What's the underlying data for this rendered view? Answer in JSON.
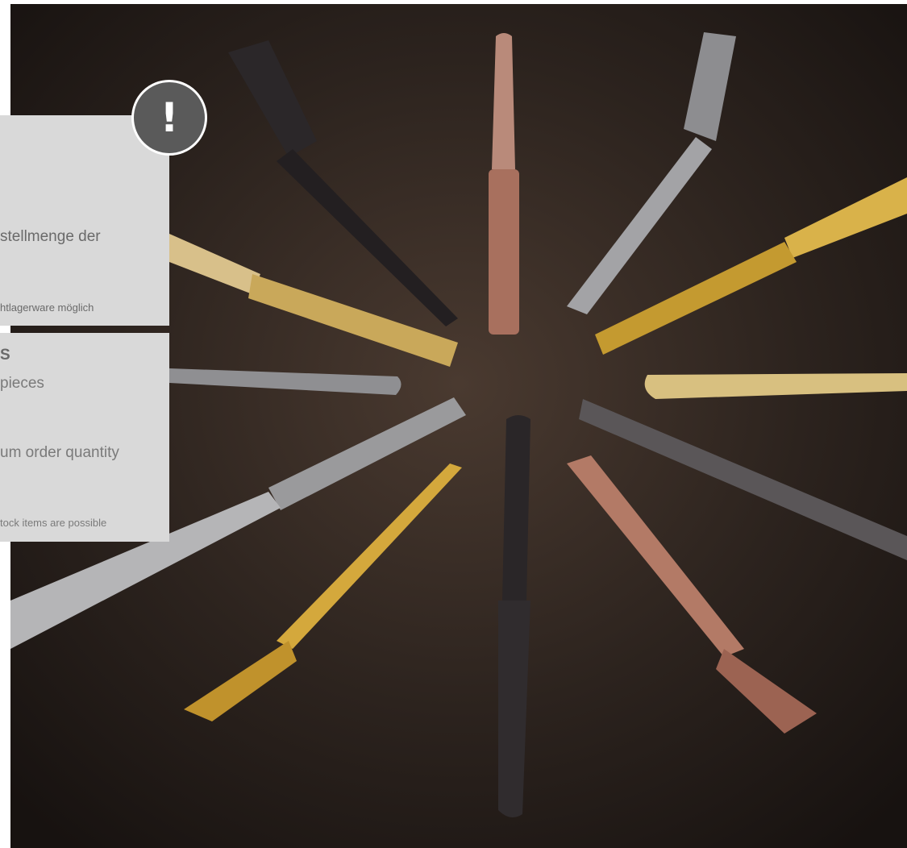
{
  "info_de": {
    "line": "stellmenge der",
    "note": "htlagerware möglich"
  },
  "info_en": {
    "heading": "S",
    "pieces": "pieces",
    "line": "um order quantity",
    "note": "tock items are possible"
  },
  "alert": {
    "icon": "exclamation-icon",
    "glyph": "!"
  },
  "colors": {
    "panel": "#d9d9d9",
    "alert": "#5a5a5a",
    "background": "#2f2520",
    "gold": "#d9b24a",
    "rose": "#b37a66",
    "black_steel": "#2a2628",
    "silver": "#9a9a9c"
  }
}
